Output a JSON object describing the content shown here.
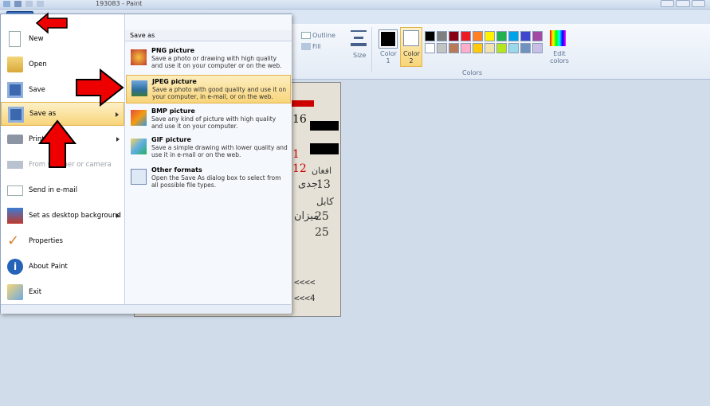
{
  "window": {
    "title": "193083 - Paint"
  },
  "ribbon": {
    "outline_label": "Outline",
    "fill_label": "Fill",
    "size_label": "Size",
    "color1_label": "Color\n1",
    "color2_label": "Color\n2",
    "edit_colors_label": "Edit\ncolors",
    "colors_group_label": "Colors"
  },
  "palette": [
    "#000000",
    "#7f7f7f",
    "#880015",
    "#ed1c24",
    "#ff7f27",
    "#fff200",
    "#22b14c",
    "#00a2e8",
    "#3f48cc",
    "#a349a4",
    "#ffffff",
    "#c3c3c3",
    "#b97a57",
    "#ffaec9",
    "#ffc90e",
    "#efe4b0",
    "#b5e61d",
    "#99d9ea",
    "#7092be",
    "#c8bfe7"
  ],
  "file_menu": {
    "items": [
      {
        "label": "New",
        "icon": "new-file-icon"
      },
      {
        "label": "Open",
        "icon": "open-folder-icon"
      },
      {
        "label": "Save",
        "icon": "save-disk-icon"
      },
      {
        "label": "Save as",
        "icon": "save-as-icon"
      },
      {
        "label": "Print",
        "icon": "printer-icon"
      },
      {
        "label": "From scanner or camera",
        "icon": "scanner-icon"
      },
      {
        "label": "Send in e-mail",
        "icon": "email-icon"
      },
      {
        "label": "Set as desktop background",
        "icon": "desktop-background-icon"
      },
      {
        "label": "Properties",
        "icon": "checkmark-icon"
      },
      {
        "label": "About Paint",
        "icon": "info-icon"
      },
      {
        "label": "Exit",
        "icon": "exit-icon"
      }
    ]
  },
  "save_as_menu": {
    "heading": "Save as",
    "items": [
      {
        "title": "PNG picture",
        "desc": "Save a photo or drawing with high quality and use it on your computer or on the web."
      },
      {
        "title": "JPEG picture",
        "desc": "Save a photo with good quality and use it on your computer, in e-mail, or on the web."
      },
      {
        "title": "BMP picture",
        "desc": "Save any kind of picture with high quality and use it on your computer."
      },
      {
        "title": "GIF picture",
        "desc": "Save a simple drawing with lower quality and use it in e-mail or on the web."
      },
      {
        "title": "Other formats",
        "desc": "Open the Save As dialog box to select from all possible file types."
      }
    ]
  },
  "canvas_text": {
    "n16": "16",
    "n1": "1",
    "n12": "12",
    "n13": "13",
    "afghan": "افغان",
    "kabul": "کابل",
    "d25a": "25",
    "d25b": "25",
    "mrz1": "<<<<",
    "mrz2": "<<<4",
    "jadi": "جدی",
    "mizan": "میزان"
  }
}
